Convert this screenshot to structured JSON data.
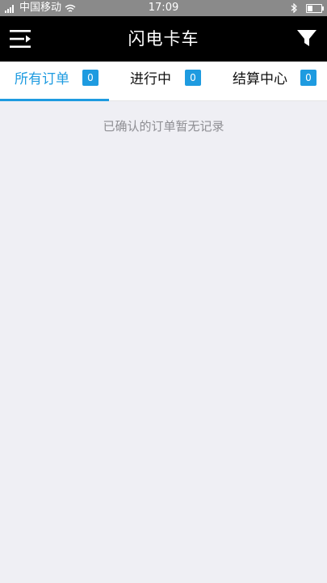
{
  "status_bar": {
    "carrier": "中国移动",
    "time": "17:09",
    "battery_level": 0.35
  },
  "header": {
    "title": "闪电卡车",
    "menu_icon": "menu-arrow-icon",
    "filter_icon": "filter-funnel-icon"
  },
  "tabs": [
    {
      "label": "所有订单",
      "count": "0",
      "active": true
    },
    {
      "label": "进行中",
      "count": "0",
      "active": false
    },
    {
      "label": "结算中心",
      "count": "0",
      "active": false
    }
  ],
  "content": {
    "empty_message": "已确认的订单暂无记录"
  },
  "colors": {
    "accent": "#1e9be0",
    "header_bg": "#000000",
    "status_bg": "#8a8a8a",
    "page_bg": "#efeff4"
  }
}
